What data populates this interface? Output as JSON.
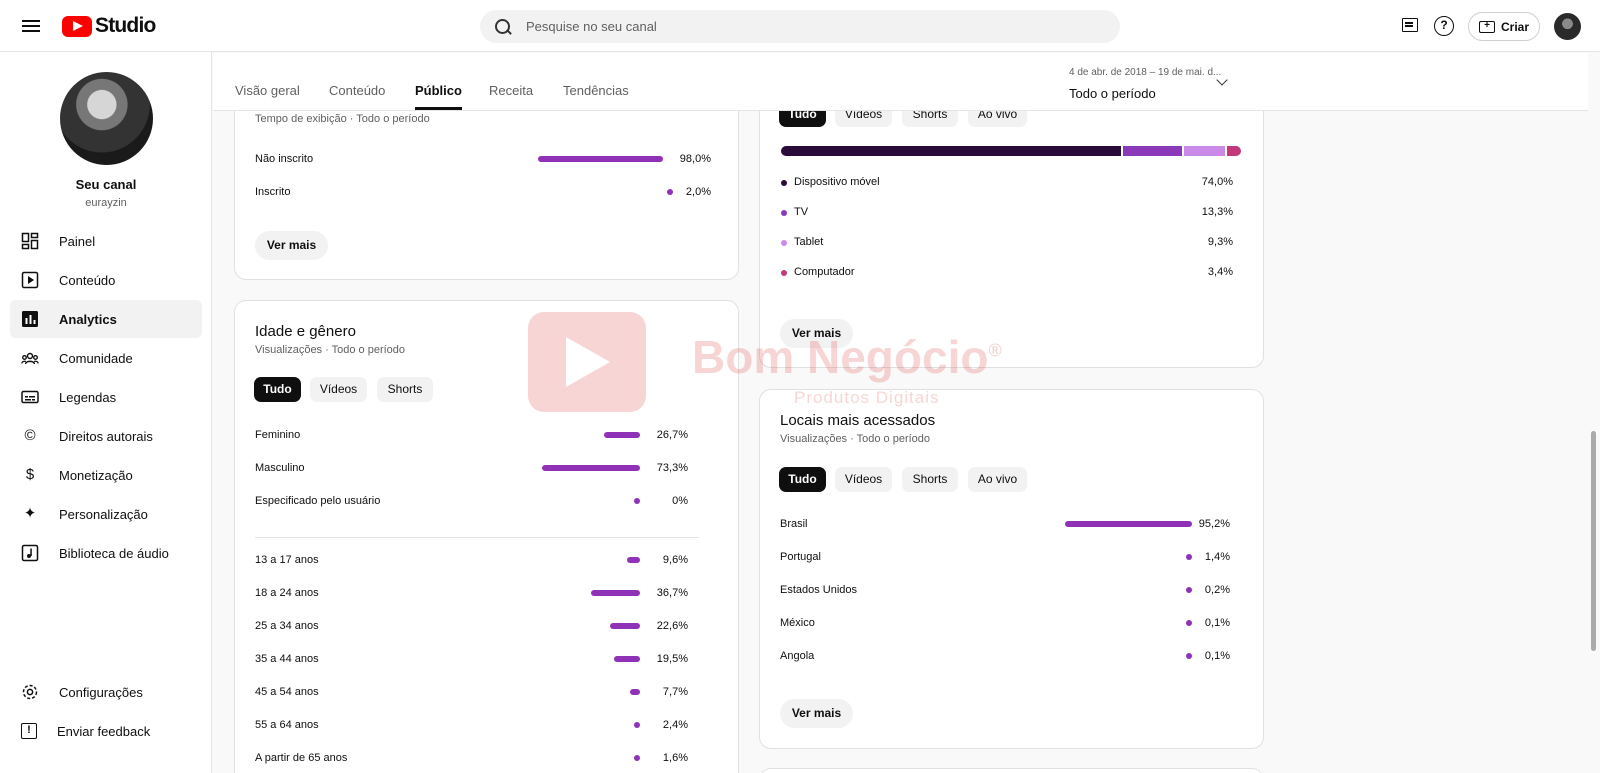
{
  "header": {
    "logo_text": "Studio",
    "search_placeholder": "Pesquise no seu canal",
    "help_glyph": "?",
    "create_label": "Criar",
    "create_glyph": "+"
  },
  "sidebar": {
    "channel_name": "Seu canal",
    "channel_handle": "eurayzin",
    "items": [
      {
        "label": "Painel",
        "icon": "dashboard-icon"
      },
      {
        "label": "Conteúdo",
        "icon": "content-icon"
      },
      {
        "label": "Analytics",
        "icon": "analytics-icon"
      },
      {
        "label": "Comunidade",
        "icon": "community-icon"
      },
      {
        "label": "Legendas",
        "icon": "subtitles-icon"
      },
      {
        "label": "Direitos autorais",
        "icon": "copyright-icon"
      },
      {
        "label": "Monetização",
        "icon": "monetization-icon"
      },
      {
        "label": "Personalização",
        "icon": "customization-icon"
      },
      {
        "label": "Biblioteca de áudio",
        "icon": "audio-library-icon"
      }
    ],
    "bottom_items": [
      {
        "label": "Configurações",
        "icon": "settings-icon"
      },
      {
        "label": "Enviar feedback",
        "icon": "feedback-icon"
      }
    ],
    "icon_glyphs": {
      "copyright": "©",
      "money": "$",
      "wand": "✦",
      "feedback": "!"
    }
  },
  "tabs": [
    "Visão geral",
    "Conteúdo",
    "Público",
    "Receita",
    "Tendências"
  ],
  "active_tab": "Público",
  "date_range": {
    "sub": "4 de abr. de 2018 – 19 de mai. d...",
    "main": "Todo o período"
  },
  "subscription_card": {
    "subtitle": "Tempo de exibição · Todo o período",
    "rows": [
      {
        "label": "Não inscrito",
        "value": "98,0%",
        "pct": 98.0
      },
      {
        "label": "Inscrito",
        "value": "2,0%",
        "pct": 2.0
      }
    ],
    "button": "Ver mais"
  },
  "age_gender_card": {
    "title": "Idade e gênero",
    "subtitle": "Visualizações · Todo o período",
    "chips": [
      "Tudo",
      "Vídeos",
      "Shorts"
    ],
    "gender_rows": [
      {
        "label": "Feminino",
        "value": "26,7%",
        "pct": 26.7
      },
      {
        "label": "Masculino",
        "value": "73,3%",
        "pct": 73.3
      },
      {
        "label": "Especificado pelo usuário",
        "value": "0%",
        "pct": 0
      }
    ],
    "age_rows": [
      {
        "label": "13 a 17 anos",
        "value": "9,6%",
        "pct": 9.6
      },
      {
        "label": "18 a 24 anos",
        "value": "36,7%",
        "pct": 36.7
      },
      {
        "label": "25 a 34 anos",
        "value": "22,6%",
        "pct": 22.6
      },
      {
        "label": "35 a 44 anos",
        "value": "19,5%",
        "pct": 19.5
      },
      {
        "label": "45 a 54 anos",
        "value": "7,7%",
        "pct": 7.7
      },
      {
        "label": "55 a 64 anos",
        "value": "2,4%",
        "pct": 2.4
      },
      {
        "label": "A partir de 65 anos",
        "value": "1,6%",
        "pct": 1.6
      }
    ]
  },
  "device_card": {
    "chips": [
      "Tudo",
      "Vídeos",
      "Shorts",
      "Ao vivo"
    ],
    "rows": [
      {
        "label": "Dispositivo móvel",
        "value": "74,0%",
        "pct": 74.0,
        "color": "#2a0a3a"
      },
      {
        "label": "TV",
        "value": "13,3%",
        "pct": 13.3,
        "color": "#8a3ab8"
      },
      {
        "label": "Tablet",
        "value": "9,3%",
        "pct": 9.3,
        "color": "#c98ae8"
      },
      {
        "label": "Computador",
        "value": "3,4%",
        "pct": 3.4,
        "color": "#c2387a"
      }
    ],
    "button": "Ver mais"
  },
  "locations_card": {
    "title": "Locais mais acessados",
    "subtitle": "Visualizações · Todo o período",
    "chips": [
      "Tudo",
      "Vídeos",
      "Shorts",
      "Ao vivo"
    ],
    "rows": [
      {
        "label": "Brasil",
        "value": "95,2%",
        "pct": 95.2
      },
      {
        "label": "Portugal",
        "value": "1,4%",
        "pct": 1.4
      },
      {
        "label": "Estados Unidos",
        "value": "0,2%",
        "pct": 0.2
      },
      {
        "label": "México",
        "value": "0,1%",
        "pct": 0.1
      },
      {
        "label": "Angola",
        "value": "0,1%",
        "pct": 0.1
      }
    ],
    "button": "Ver mais"
  },
  "watermark": {
    "title": "Bom Negócio",
    "registered": "®",
    "subtitle": "Produtos Digitais"
  },
  "colors": {
    "bar": "#9032b8",
    "accent_red": "#ff0000"
  }
}
